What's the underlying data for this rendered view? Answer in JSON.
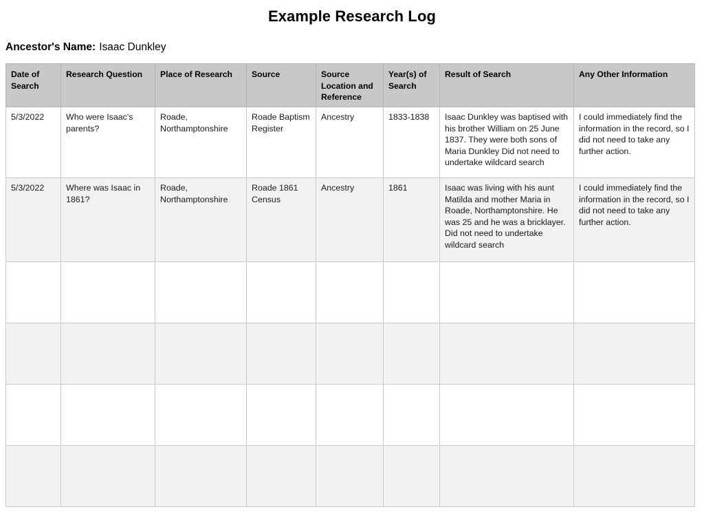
{
  "document": {
    "title": "Example Research Log",
    "ancestor_label": "Ancestor's Name:",
    "ancestor_name": "Isaac Dunkley"
  },
  "colors": {
    "header_background": "#c8c8c8",
    "row_alternate": "#f2f2f2",
    "row_default": "#ffffff",
    "border": "#c9c9c9",
    "text": "#1a1a1a",
    "page_background": "#ffffff"
  },
  "table": {
    "columns": [
      {
        "key": "date_of_search",
        "label": "Date of Search"
      },
      {
        "key": "research_question",
        "label": "Research Question"
      },
      {
        "key": "place_of_research",
        "label": "Place of Research"
      },
      {
        "key": "source",
        "label": "Source"
      },
      {
        "key": "source_location_and_reference",
        "label": "Source Location and Reference"
      },
      {
        "key": "years_of_search",
        "label": "Year(s) of Search"
      },
      {
        "key": "result_of_search",
        "label": "Result of Search"
      },
      {
        "key": "any_other_information",
        "label": "Any Other Information"
      }
    ],
    "rows": [
      {
        "date_of_search": "5/3/2022",
        "research_question": "Who were Isaac's parents?",
        "place_of_research": "Roade, Northamptonshire",
        "source": "Roade Baptism Register",
        "source_location_and_reference": "Ancestry",
        "years_of_search": "1833-1838",
        "result_of_search": "Isaac Dunkley was baptised with his brother William on 25 June 1837.  They were both sons of Maria Dunkley Did not need to undertake wildcard search",
        "any_other_information": "I could immediately find the information in the record, so I did not need to take any further action."
      },
      {
        "date_of_search": "5/3/2022",
        "research_question": "Where was Isaac in 1861?",
        "place_of_research": "Roade, Northamptonshire",
        "source": "Roade 1861 Census",
        "source_location_and_reference": "Ancestry",
        "years_of_search": "1861",
        "result_of_search": "Isaac was living with his aunt Matilda and mother Maria in Roade, Northamptonshire.  He was 25 and he was a bricklayer. Did not need to undertake wildcard search",
        "any_other_information": "I could immediately find the information in the record, so I did not need to take any further action."
      },
      {
        "date_of_search": "",
        "research_question": "",
        "place_of_research": "",
        "source": "",
        "source_location_and_reference": "",
        "years_of_search": "",
        "result_of_search": "",
        "any_other_information": ""
      },
      {
        "date_of_search": "",
        "research_question": "",
        "place_of_research": "",
        "source": "",
        "source_location_and_reference": "",
        "years_of_search": "",
        "result_of_search": "",
        "any_other_information": ""
      },
      {
        "date_of_search": "",
        "research_question": "",
        "place_of_research": "",
        "source": "",
        "source_location_and_reference": "",
        "years_of_search": "",
        "result_of_search": "",
        "any_other_information": ""
      },
      {
        "date_of_search": "",
        "research_question": "",
        "place_of_research": "",
        "source": "",
        "source_location_and_reference": "",
        "years_of_search": "",
        "result_of_search": "",
        "any_other_information": ""
      }
    ]
  }
}
